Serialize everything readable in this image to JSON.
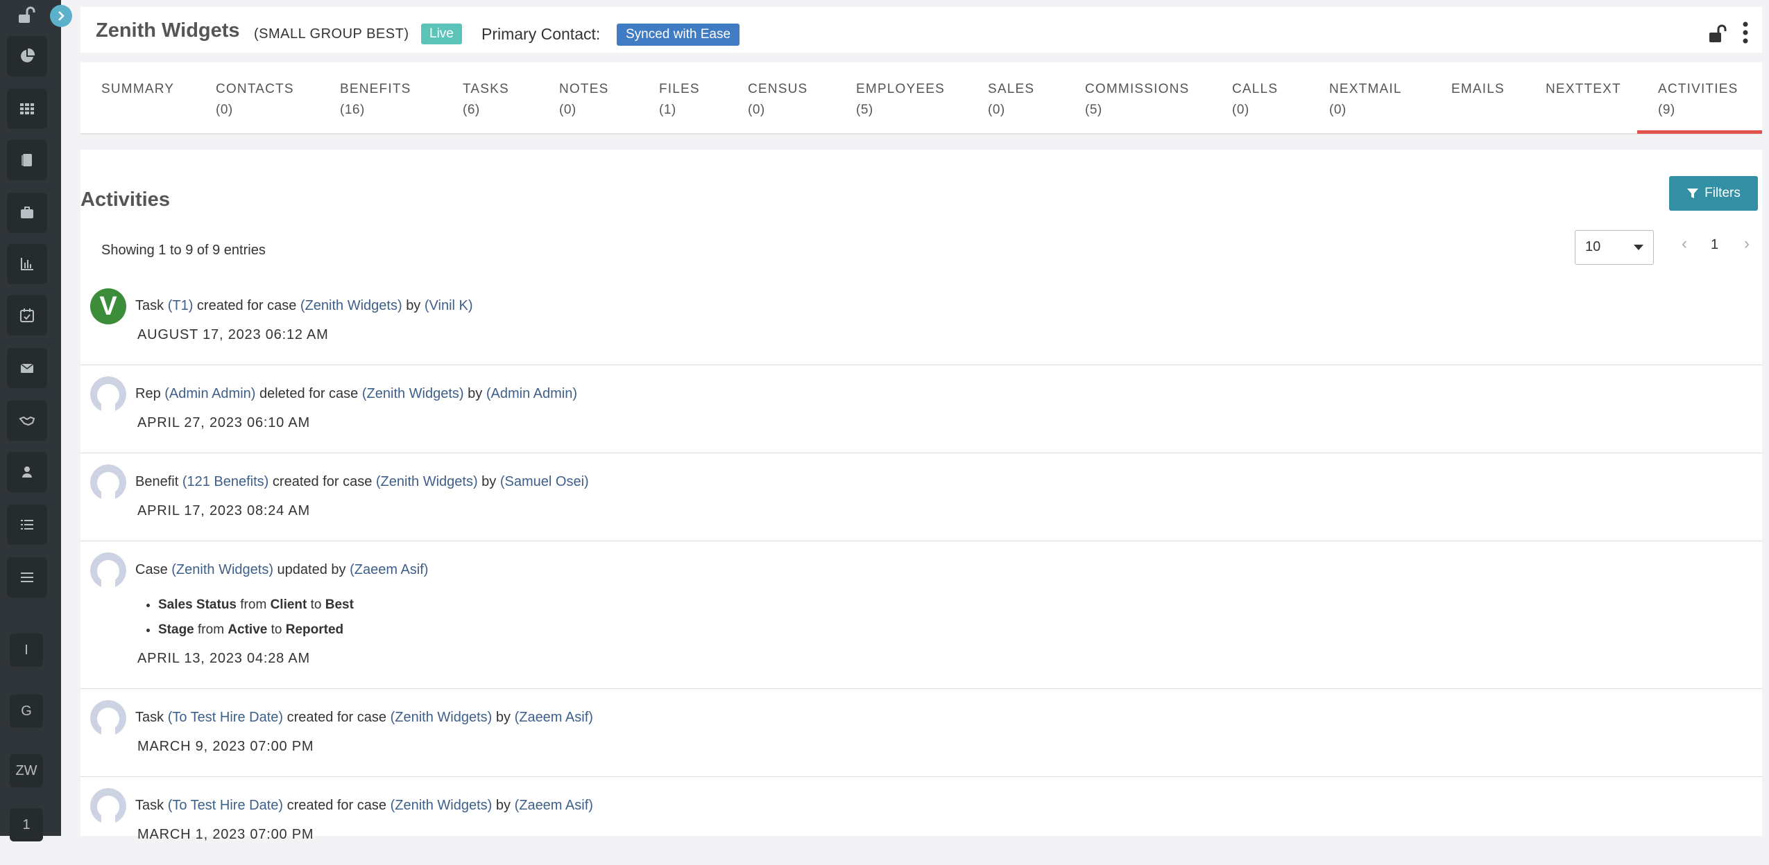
{
  "header": {
    "title": "Zenith Widgets",
    "case_type": "(SMALL GROUP BEST)",
    "status_badge": "Live",
    "primary_contact_label": "Primary Contact:",
    "primary_contact_value": "Synced with Ease"
  },
  "sidebar": {
    "items": [
      "dashboard-icon",
      "apps-icon",
      "book-icon",
      "briefcase-icon",
      "chart-icon",
      "calendar-check-icon",
      "mail-icon",
      "handshake-icon",
      "user-icon",
      "list-icon",
      "menu-icon"
    ],
    "letters": [
      "I",
      "G",
      "ZW",
      "1"
    ]
  },
  "tabs": [
    {
      "label": "SUMMARY",
      "count": ""
    },
    {
      "label": "CONTACTS",
      "count": "(0)"
    },
    {
      "label": "BENEFITS",
      "count": "(16)"
    },
    {
      "label": "TASKS",
      "count": "(6)"
    },
    {
      "label": "NOTES",
      "count": "(0)"
    },
    {
      "label": "FILES",
      "count": "(1)"
    },
    {
      "label": "CENSUS",
      "count": "(0)"
    },
    {
      "label": "EMPLOYEES",
      "count": "(5)"
    },
    {
      "label": "SALES",
      "count": "(0)"
    },
    {
      "label": "COMMISSIONS",
      "count": "(5)"
    },
    {
      "label": "CALLS",
      "count": "(0)"
    },
    {
      "label": "NEXTMAIL",
      "count": "(0)"
    },
    {
      "label": "EMAILS",
      "count": ""
    },
    {
      "label": "NEXTTEXT",
      "count": ""
    },
    {
      "label": "ACTIVITIES",
      "count": "(9)"
    }
  ],
  "main": {
    "title": "Activities",
    "filter_label": "Filters",
    "showing": "Showing 1 to 9 of 9 entries",
    "per_page": "10",
    "page": "1"
  },
  "activities": [
    {
      "avatar": "V",
      "pre": "Task",
      "l1": "(T1)",
      "mid": "created for case",
      "l2": "(Zenith Widgets)",
      "by": "by",
      "l3": "(Vinil K)",
      "date": "AUGUST 17, 2023 06:12 AM"
    },
    {
      "avatar": "",
      "pre": "Rep",
      "l1": "(Admin Admin)",
      "mid": "deleted for case",
      "l2": "(Zenith Widgets)",
      "by": "by",
      "l3": "(Admin Admin)",
      "date": "APRIL 27, 2023 06:10 AM"
    },
    {
      "avatar": "",
      "pre": "Benefit",
      "l1": "(121 Benefits)",
      "mid": "created for case",
      "l2": "(Zenith Widgets)",
      "by": "by",
      "l3": "(Samuel Osei)",
      "date": "APRIL 17, 2023 08:24 AM"
    },
    {
      "avatar": "",
      "pre": "Case",
      "l1": "(Zenith Widgets)",
      "mid": "updated by",
      "l2": "(Zaeem Asif)",
      "by": "",
      "l3": "",
      "date": "APRIL 13, 2023 04:28 AM",
      "changes": [
        {
          "field": "Sales Status",
          "from_word": "from",
          "from": "Client",
          "to_word": "to",
          "to": "Best"
        },
        {
          "field": "Stage",
          "from_word": "from",
          "from": "Active",
          "to_word": "to",
          "to": "Reported"
        }
      ]
    },
    {
      "avatar": "",
      "pre": "Task",
      "l1": "(To Test Hire Date)",
      "mid": "created for case",
      "l2": "(Zenith Widgets)",
      "by": "by",
      "l3": "(Zaeem Asif)",
      "date": "MARCH 9, 2023 07:00 PM"
    },
    {
      "avatar": "",
      "pre": "Task",
      "l1": "(To Test Hire Date)",
      "mid": "created for case",
      "l2": "(Zenith Widgets)",
      "by": "by",
      "l3": "(Zaeem Asif)",
      "date": "MARCH 1, 2023 07:00 PM"
    }
  ]
}
